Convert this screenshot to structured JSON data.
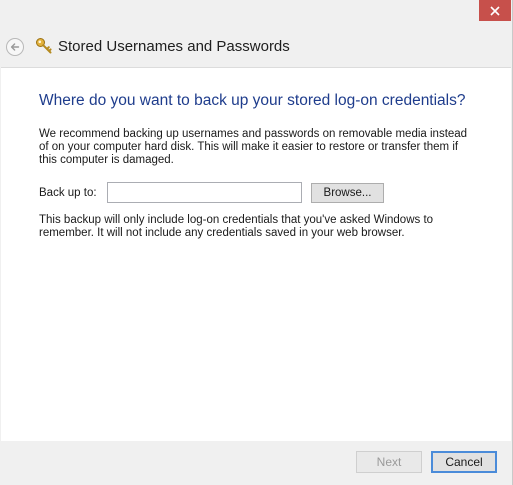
{
  "window": {
    "title": "Stored Usernames and Passwords",
    "close_icon": "close-icon",
    "back_icon": "back-arrow-icon",
    "title_icon": "key-icon"
  },
  "main": {
    "heading": "Where do you want to back up your stored log-on credentials?",
    "intro": "We recommend backing up usernames and passwords on removable media instead of on your computer hard disk. This will make it easier to restore or transfer them if this computer is damaged.",
    "backup_label": "Back up to:",
    "backup_value": "",
    "browse_label": "Browse...",
    "note": "This backup will only  include log-on credentials that you've asked Windows to remember. It will not include any credentials saved in your web browser."
  },
  "footer": {
    "next_label": "Next",
    "cancel_label": "Cancel"
  },
  "colors": {
    "heading": "#1e3c8c",
    "close_button": "#c7504b",
    "focus_border": "#4a8bd9"
  }
}
